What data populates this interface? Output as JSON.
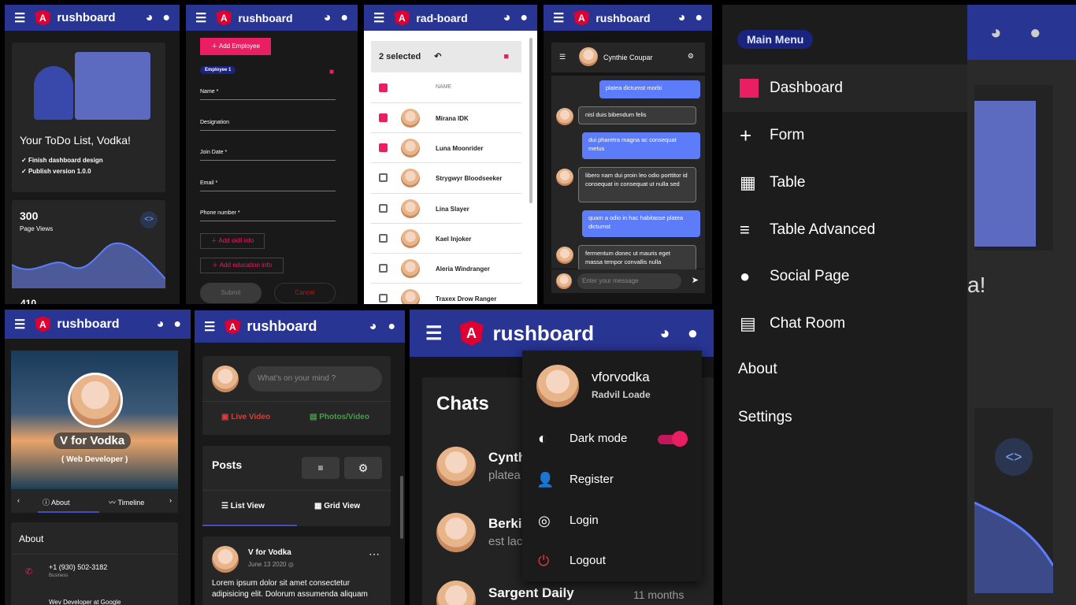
{
  "brand": {
    "name": "rushboard",
    "alt_name": "rad-board"
  },
  "todo": {
    "title": "Your ToDo List, Vodka!",
    "items": [
      "Finish dashboard design",
      "Publish version 1.0.0"
    ]
  },
  "stats": {
    "value": "300",
    "label": "Page Views",
    "next_value": "410"
  },
  "employee": {
    "add_button": "Add Employee",
    "chip": "Employee 1",
    "fields": [
      "Name *",
      "Designation",
      "Join Date *",
      "Email *",
      "Phone number *"
    ],
    "add_skill": "Add skill info",
    "add_edu": "Add education info",
    "submit": "Submit",
    "cancel": "Cancel"
  },
  "table": {
    "selected": "2 selected",
    "col_name": "NAME",
    "rows": [
      {
        "name": "Mirana IDK",
        "checked": true
      },
      {
        "name": "Luna Moonrider",
        "checked": true
      },
      {
        "name": "Strygwyr Bloodseeker",
        "checked": false
      },
      {
        "name": "Lina Slayer",
        "checked": false
      },
      {
        "name": "Kael Injoker",
        "checked": false
      },
      {
        "name": "Aleria Windranger",
        "checked": false
      },
      {
        "name": "Traxex Drow Ranger",
        "checked": false
      }
    ]
  },
  "chat": {
    "contact": "Cynthie Coupar",
    "messages": [
      {
        "text": "platea dictumst morbi",
        "me": true
      },
      {
        "text": "nisl duis bibendum felis",
        "me": false
      },
      {
        "text": "dui pharetra magna ac consequat metus",
        "me": true
      },
      {
        "text": "libero nam dui proin leo odio porttitor id consequat in consequat ut nulla sed",
        "me": false
      },
      {
        "text": "quam a odio in hac habitasse platea dictumst",
        "me": true
      },
      {
        "text": "fermentum donec ut mauris eget massa tempor convallis nulla",
        "me": false
      }
    ],
    "placeholder": "Enter your message"
  },
  "menu": {
    "chip": "Main Menu",
    "items": [
      "Dashboard",
      "Form",
      "Table",
      "Table Advanced",
      "Social Page",
      "Chat Room"
    ],
    "about": "About",
    "settings": "Settings",
    "bg_text": "a!"
  },
  "profile": {
    "name": "V for Vodka",
    "role": "( Web Developer )",
    "tabs": [
      "About",
      "Timeline"
    ],
    "about_title": "About",
    "phone": "+1 (930) 502-3182",
    "phone_type": "Business",
    "work": "Wev Developer at Google"
  },
  "feed": {
    "placeholder": "What's on your mind ?",
    "live": "Live Video",
    "photos": "Photos/Video",
    "posts_title": "Posts",
    "list_view": "List View",
    "grid_view": "Grid View",
    "post_author": "V for Vodka",
    "post_date": "June 13 2020",
    "post_text": "Lorem ipsum dolor sit amet consectetur adipisicing elit. Dolorum assumenda aliquam"
  },
  "account": {
    "username": "vforvodka",
    "fullname": "Radvil Loade",
    "items": [
      "Dark mode",
      "Register",
      "Login",
      "Logout"
    ],
    "chats_title": "Chats",
    "chat_names": [
      "Cynth",
      "Berki",
      "Sargent Daily"
    ],
    "chat_previews": [
      "platea",
      "est lac"
    ],
    "chat_time": "11 months"
  }
}
